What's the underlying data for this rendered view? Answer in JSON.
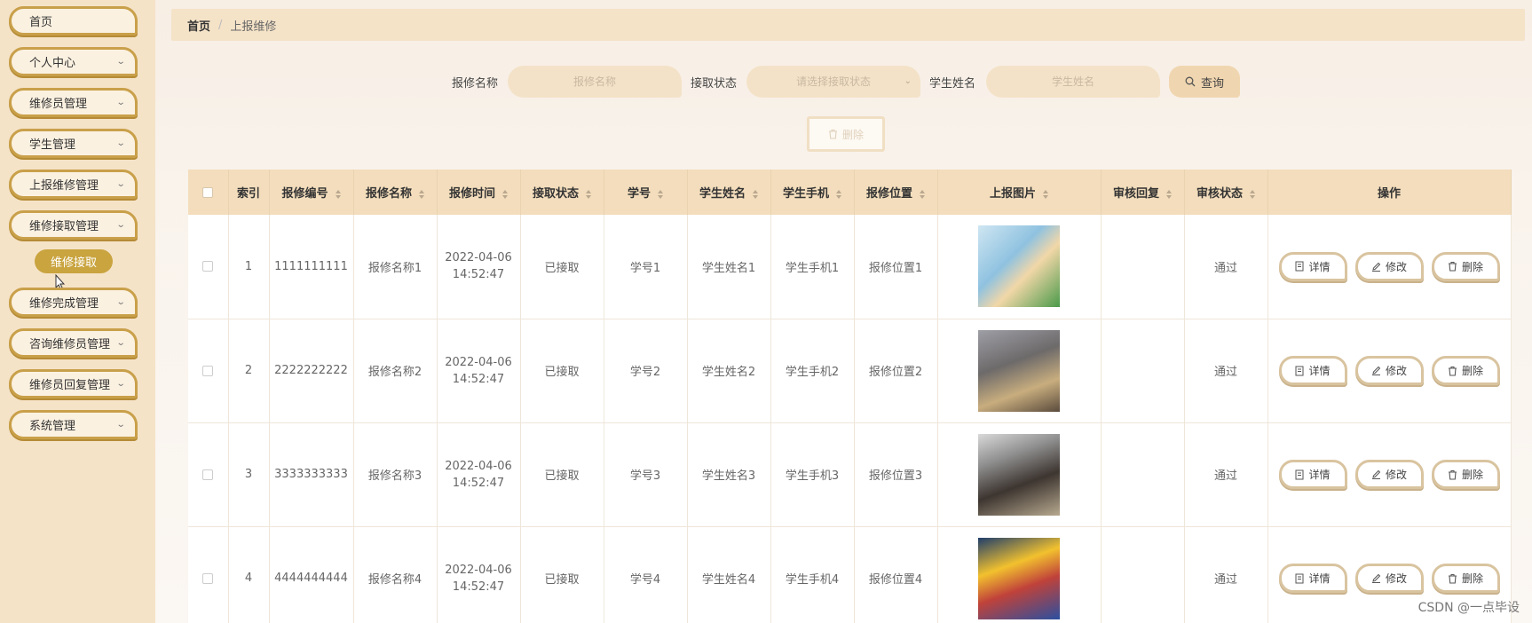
{
  "sidebar": {
    "items": [
      {
        "label": "首页"
      },
      {
        "label": "个人中心"
      },
      {
        "label": "维修员管理"
      },
      {
        "label": "学生管理"
      },
      {
        "label": "上报维修管理"
      },
      {
        "label": "维修接取管理"
      },
      {
        "label": "维修完成管理"
      },
      {
        "label": "咨询维修员管理"
      },
      {
        "label": "维修员回复管理"
      },
      {
        "label": "系统管理"
      }
    ],
    "active_submenu": "维修接取"
  },
  "breadcrumb": {
    "home": "首页",
    "separator": "/",
    "current": "上报维修"
  },
  "search": {
    "name_label": "报修名称",
    "name_placeholder": "报修名称",
    "status_label": "接取状态",
    "status_placeholder": "请选择接取状态",
    "student_label": "学生姓名",
    "student_placeholder": "学生姓名",
    "query_label": "查询"
  },
  "toolbar": {
    "delete_label": "删除"
  },
  "table": {
    "headers": [
      "索引",
      "报修编号",
      "报修名称",
      "报修时间",
      "接取状态",
      "学号",
      "学生姓名",
      "学生手机",
      "报修位置",
      "上报图片",
      "审核回复",
      "审核状态",
      "操作"
    ],
    "rows": [
      {
        "index": "1",
        "code": "1111111111",
        "name": "报修名称1",
        "date": "2022-04-06",
        "time": "14:52:47",
        "status": "已接取",
        "student_no": "学号1",
        "student_name": "学生姓名1",
        "phone": "学生手机1",
        "location": "报修位置1",
        "reply": "",
        "audit": "通过"
      },
      {
        "index": "2",
        "code": "2222222222",
        "name": "报修名称2",
        "date": "2022-04-06",
        "time": "14:52:47",
        "status": "已接取",
        "student_no": "学号2",
        "student_name": "学生姓名2",
        "phone": "学生手机2",
        "location": "报修位置2",
        "reply": "",
        "audit": "通过"
      },
      {
        "index": "3",
        "code": "3333333333",
        "name": "报修名称3",
        "date": "2022-04-06",
        "time": "14:52:47",
        "status": "已接取",
        "student_no": "学号3",
        "student_name": "学生姓名3",
        "phone": "学生手机3",
        "location": "报修位置3",
        "reply": "",
        "audit": "通过"
      },
      {
        "index": "4",
        "code": "4444444444",
        "name": "报修名称4",
        "date": "2022-04-06",
        "time": "14:52:47",
        "status": "已接取",
        "student_no": "学号4",
        "student_name": "学生姓名4",
        "phone": "学生手机4",
        "location": "报修位置4",
        "reply": "",
        "audit": "通过"
      }
    ],
    "actions": {
      "detail": "详情",
      "edit": "修改",
      "delete": "删除"
    }
  },
  "watermark": "CSDN @一点毕设",
  "colors": {
    "accent": "#c9a04a",
    "header_bg": "#f3ddbc",
    "sidebar_bg": "#f5e3c8"
  }
}
